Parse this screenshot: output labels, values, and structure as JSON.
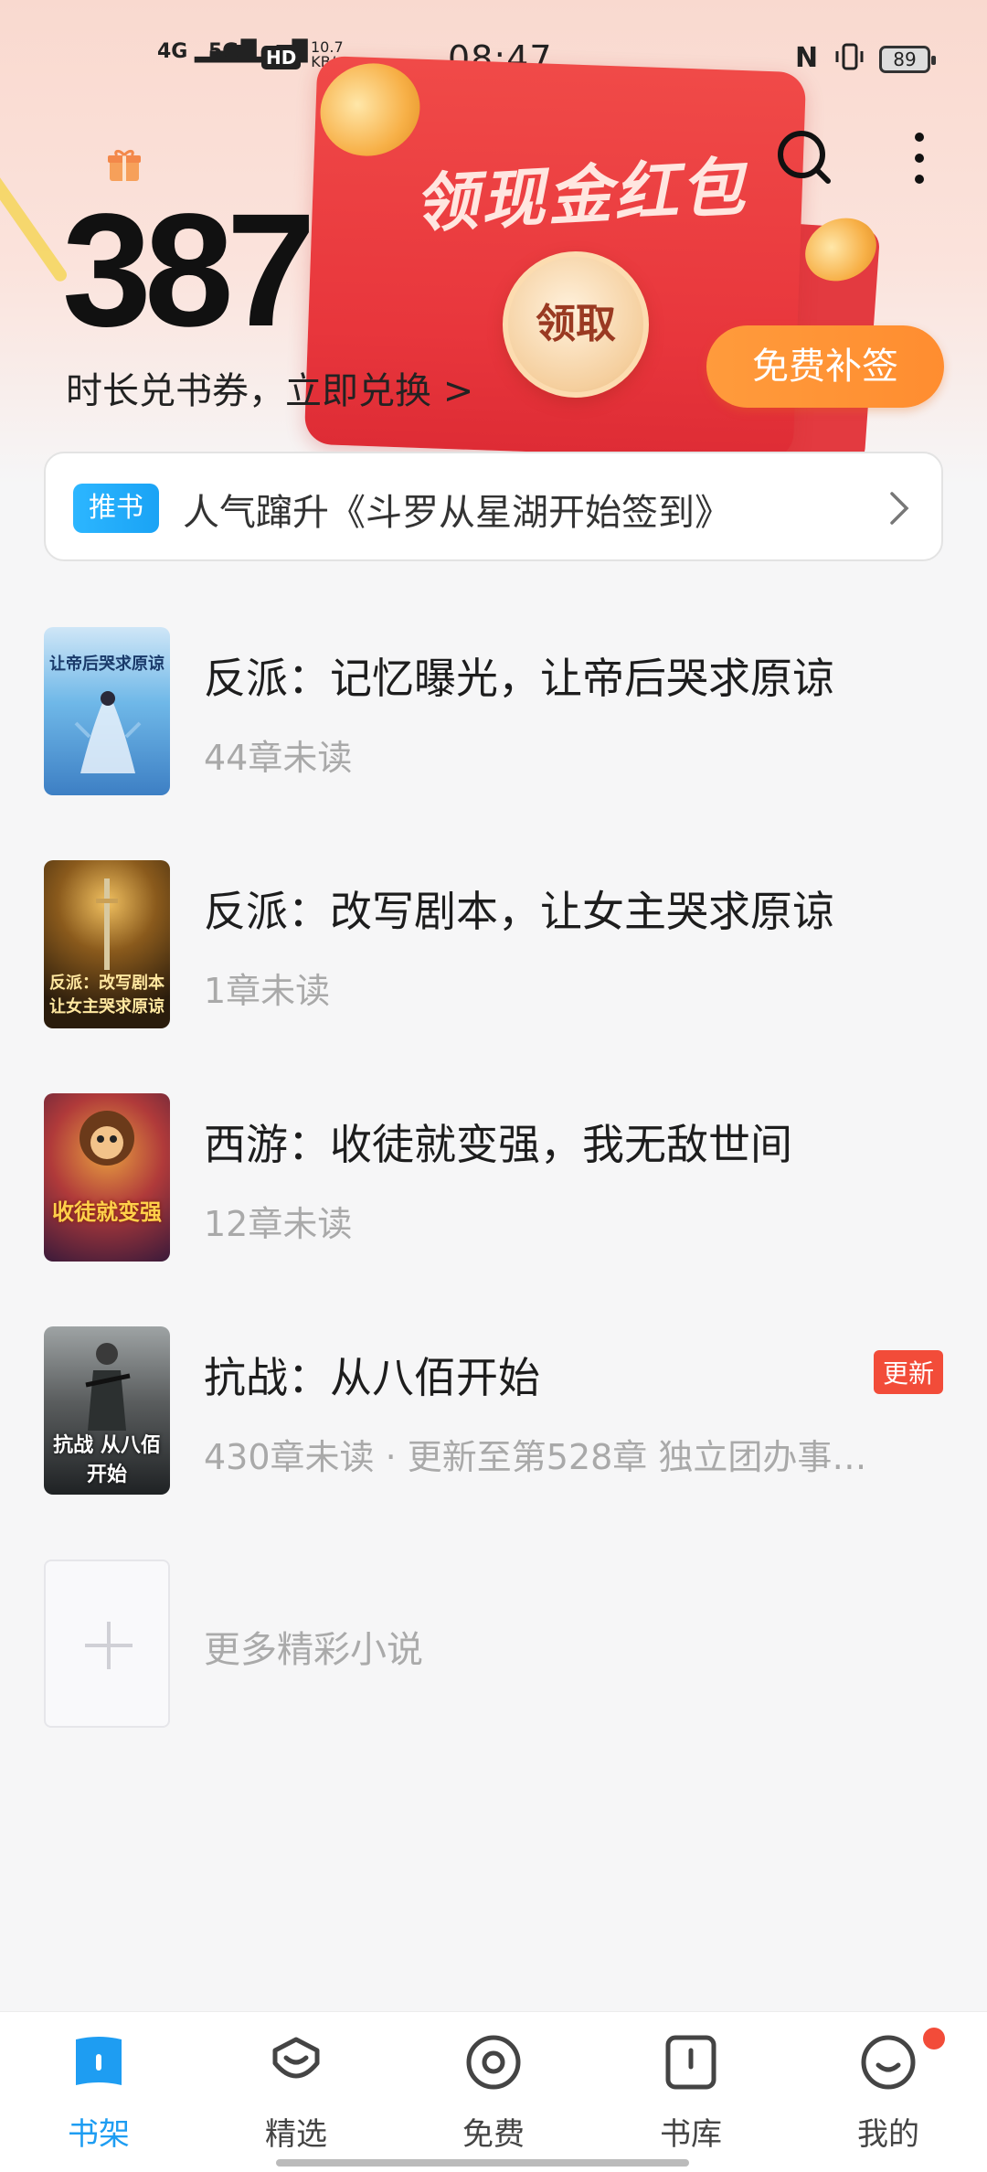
{
  "status_bar": {
    "signal_4g": "4G",
    "signal_5g": "5G",
    "hd": "HD",
    "speed_value": "10.7",
    "speed_unit": "KB/s",
    "time": "08:47",
    "battery": "89"
  },
  "header": {
    "score": "387",
    "score_subtitle": "时长兑书券，立即兑换 >",
    "banner_title": "领现金红包",
    "claim_label": "领取",
    "free_sign_label": "免费补签"
  },
  "recommend": {
    "badge": "推书",
    "text": "人气蹿升《斗罗从星湖开始签到》"
  },
  "books": [
    {
      "title": "反派：记忆曝光，让帝后哭求原谅",
      "subtitle": "44章未读",
      "cover_text": "让帝后哭求原谅",
      "cover_colors": [
        "#6fb8e8",
        "#3d7fc4"
      ],
      "updated": false
    },
    {
      "title": "反派：改写剧本，让女主哭求原谅",
      "subtitle": "1章未读",
      "cover_text": "反派：改写剧本 让女主哭求原谅",
      "cover_colors": [
        "#3b2a14",
        "#b07a2a"
      ],
      "updated": false
    },
    {
      "title": "西游：收徒就变强，我无敌世间",
      "subtitle": "12章未读",
      "cover_text": "收徒就变强",
      "cover_colors": [
        "#7b2030",
        "#e2a13a"
      ],
      "updated": false
    },
    {
      "title": "抗战：从八佰开始",
      "subtitle": "430章未读 · 更新至第528章 独立团办事…",
      "cover_text": "抗战 从八佰开始",
      "cover_colors": [
        "#5a5d5e",
        "#1f2224"
      ],
      "updated": true,
      "update_label": "更新"
    }
  ],
  "more_novels": "更多精彩小说",
  "nav": [
    {
      "label": "书架",
      "icon": "bookshelf-icon",
      "active": true
    },
    {
      "label": "精选",
      "icon": "featured-icon",
      "active": false
    },
    {
      "label": "免费",
      "icon": "free-icon",
      "active": false
    },
    {
      "label": "书库",
      "icon": "library-icon",
      "active": false
    },
    {
      "label": "我的",
      "icon": "profile-icon",
      "active": false
    }
  ],
  "colors": {
    "accent": "#1e9df2",
    "envelope_red": "#e8363c",
    "update_badge": "#f24c39",
    "free_sign_orange": "#ff9b3c"
  }
}
